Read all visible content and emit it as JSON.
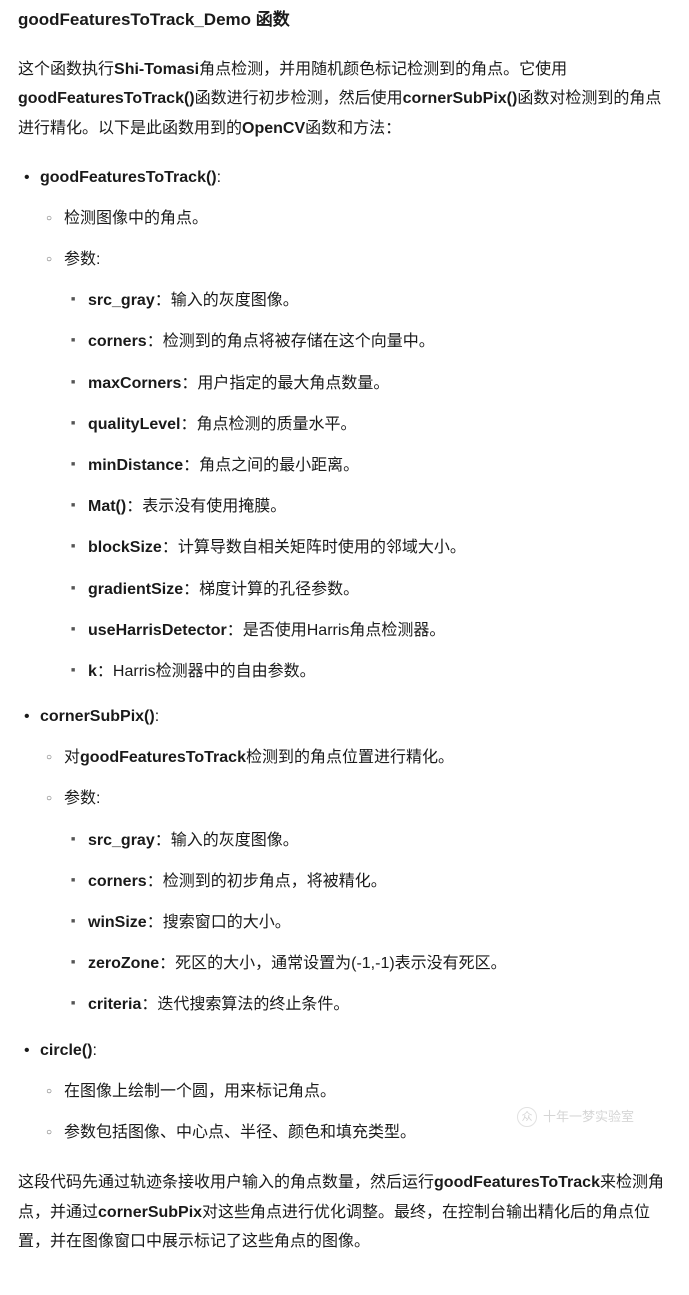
{
  "title": "goodFeaturesToTrack_Demo 函数",
  "intro_parts": {
    "p1": "这个函数执行",
    "p2": "Shi-Tomasi",
    "p3": "角点检测，并用随机颜色标记检测到的角点。它使用",
    "p4": "goodFeaturesToTrack()",
    "p5": "函数进行初步检测，然后使用",
    "p6": "cornerSubPix()",
    "p7": "函数对检测到的角点进行精化。以下是此函数用到的",
    "p8": "OpenCV",
    "p9": "函数和方法："
  },
  "functions": [
    {
      "name": "goodFeaturesToTrack()",
      "suffix": ":",
      "notes": [
        {
          "text": "检测图像中的角点。"
        },
        {
          "text": "参数:",
          "params": [
            {
              "name": "src_gray",
              "desc": "：输入的灰度图像。"
            },
            {
              "name": "corners",
              "desc": "：检测到的角点将被存储在这个向量中。"
            },
            {
              "name": "maxCorners",
              "desc": "：用户指定的最大角点数量。"
            },
            {
              "name": "qualityLevel",
              "desc": "：角点检测的质量水平。"
            },
            {
              "name": "minDistance",
              "desc": "：角点之间的最小距离。"
            },
            {
              "name": "Mat()",
              "desc": "：表示没有使用掩膜。"
            },
            {
              "name": "blockSize",
              "desc": "：计算导数自相关矩阵时使用的邻域大小。"
            },
            {
              "name": "gradientSize",
              "desc": "：梯度计算的孔径参数。"
            },
            {
              "name": "useHarrisDetector",
              "desc": "：是否使用Harris角点检测器。"
            },
            {
              "name": "k",
              "desc": "：Harris检测器中的自由参数。"
            }
          ]
        }
      ]
    },
    {
      "name": "cornerSubPix()",
      "suffix": ":",
      "notes": [
        {
          "prefix": "对",
          "bold": "goodFeaturesToTrack",
          "suffix": "检测到的角点位置进行精化。"
        },
        {
          "text": "参数:",
          "params": [
            {
              "name": "src_gray",
              "desc": "：输入的灰度图像。"
            },
            {
              "name": "corners",
              "desc": "：检测到的初步角点，将被精化。"
            },
            {
              "name": "winSize",
              "desc": "：搜索窗口的大小。"
            },
            {
              "name": "zeroZone",
              "desc": "：死区的大小，通常设置为(-1,-1)表示没有死区。"
            },
            {
              "name": "criteria",
              "desc": "：迭代搜索算法的终止条件。"
            }
          ]
        }
      ]
    },
    {
      "name": "circle()",
      "suffix": ":",
      "notes": [
        {
          "text": "在图像上绘制一个圆，用来标记角点。"
        },
        {
          "text": "参数包括图像、中心点、半径、颜色和填充类型。"
        }
      ]
    }
  ],
  "outro": {
    "p1": "这段代码先通过轨迹条接收用户输入的角点数量，然后运行",
    "p2": "goodFeaturesToTrack",
    "p3": "来检测角点，并通过",
    "p4": "cornerSubPix",
    "p5": "对这些角点进行优化调整。最终，在控制台输出精化后的角点位置，并在图像窗口中展示标记了这些角点的图像。"
  },
  "watermark": "十年一梦实验室"
}
